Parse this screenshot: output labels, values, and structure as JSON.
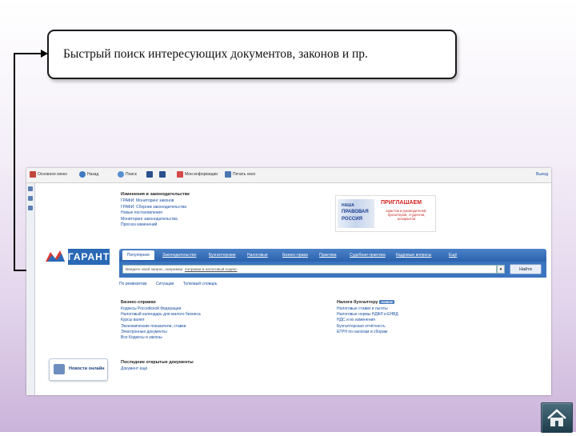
{
  "callout": {
    "text": "Быстрый поиск интересующих документов, законов и пр."
  },
  "toolbar": {
    "items": [
      "Основное меню",
      "Назад",
      "Поиск",
      "Мои информации",
      "Печать окно"
    ],
    "exit": "Выход"
  },
  "news": {
    "header": "Изменения в законодательстве",
    "items": [
      "ГРАФИ: Мониторинг законов",
      "ГРАФИ: Сборник законодательства",
      "Новые постановления",
      "Мониторинг законодательства",
      "Прогноз изменений"
    ]
  },
  "banner": {
    "flag_lines": [
      "НАША",
      "ПРАВОВАЯ",
      "РОССИЯ"
    ],
    "title": "ПРИГЛАШАЕМ",
    "subtitle": "юристов и руководителей, бухгалтеров, студентов, аспирантов"
  },
  "logo": {
    "text": "ГАРАНТ"
  },
  "nav": {
    "active": "Популярное",
    "items": [
      "Законодательство",
      "Бухгалтерские",
      "Налоговые",
      "Бизнес-права",
      "Практика",
      "Судебная практика",
      "Кадровые вопросы",
      "Ещё"
    ]
  },
  "search": {
    "placeholder": "Введите свой запрос, например: ",
    "example": "поправки в налоговый кодекс",
    "button": "Найти"
  },
  "options": [
    "По реквизитам",
    "Ситуации",
    "Толковый словарь"
  ],
  "left_col": {
    "header": "Бизнес-справки",
    "items": [
      "Кодексы Российской Федерации",
      "Налоговый календарь для малого бизнеса",
      "Курсы валют",
      "Экономические показатели, ставки",
      "Электронные документы",
      "Все Кодексы и законы"
    ]
  },
  "right_col": {
    "header": "Налоги бухгалтеру",
    "badge": "НОВОЕ",
    "items": [
      "Налоговые ставки и льготы",
      "Налоговые нормы НДФЛ и ЕНВД",
      "НДС и их изменения",
      "Бухгалтерская отчётность",
      "ЕГРН по налогам и сборам"
    ]
  },
  "newsbox": {
    "label": "Новости онлайн"
  },
  "last_docs": {
    "header": "Последние открытые документы",
    "item": "Документ ещё"
  }
}
